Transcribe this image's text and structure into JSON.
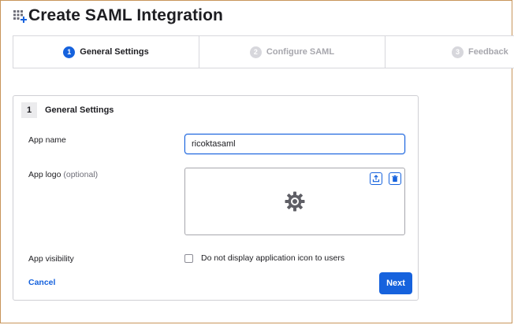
{
  "header": {
    "title": "Create SAML Integration",
    "icon": "grid-add-icon"
  },
  "steps": [
    {
      "num": "1",
      "label": "General Settings",
      "active": true
    },
    {
      "num": "2",
      "label": "Configure SAML",
      "active": false
    },
    {
      "num": "3",
      "label": "Feedback",
      "active": false
    }
  ],
  "card": {
    "badge": "1",
    "title": "General Settings",
    "app_name_label": "App name",
    "app_name_value": "ricoktasaml",
    "app_logo_label": "App logo",
    "app_logo_optional": "(optional)",
    "app_visibility_label": "App visibility",
    "visibility_checkbox_label": "Do not display application icon to users",
    "visibility_checked": false,
    "cancel_label": "Cancel",
    "next_label": "Next"
  },
  "colors": {
    "accent": "#1662dd",
    "frame_border": "#c8955a",
    "inactive_text": "#a7a7ad"
  }
}
